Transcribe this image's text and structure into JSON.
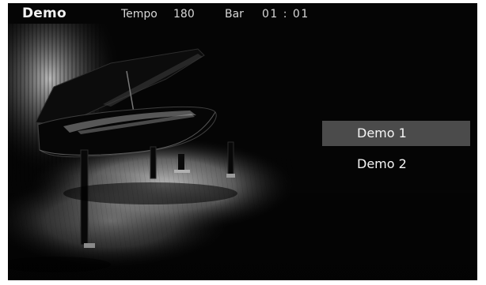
{
  "header": {
    "title": "Demo",
    "tempo_label": "Tempo",
    "tempo_value": "180",
    "bar_label": "Bar",
    "bar_value": "01 : 01"
  },
  "background": {
    "subject": "grand-piano"
  },
  "menu": {
    "items": [
      {
        "label": "Demo 1",
        "selected": true
      },
      {
        "label": "Demo 2",
        "selected": false
      }
    ]
  },
  "colors": {
    "background": "#050505",
    "selected_item": "#4b4b4b",
    "text": "#f5f5f5"
  }
}
